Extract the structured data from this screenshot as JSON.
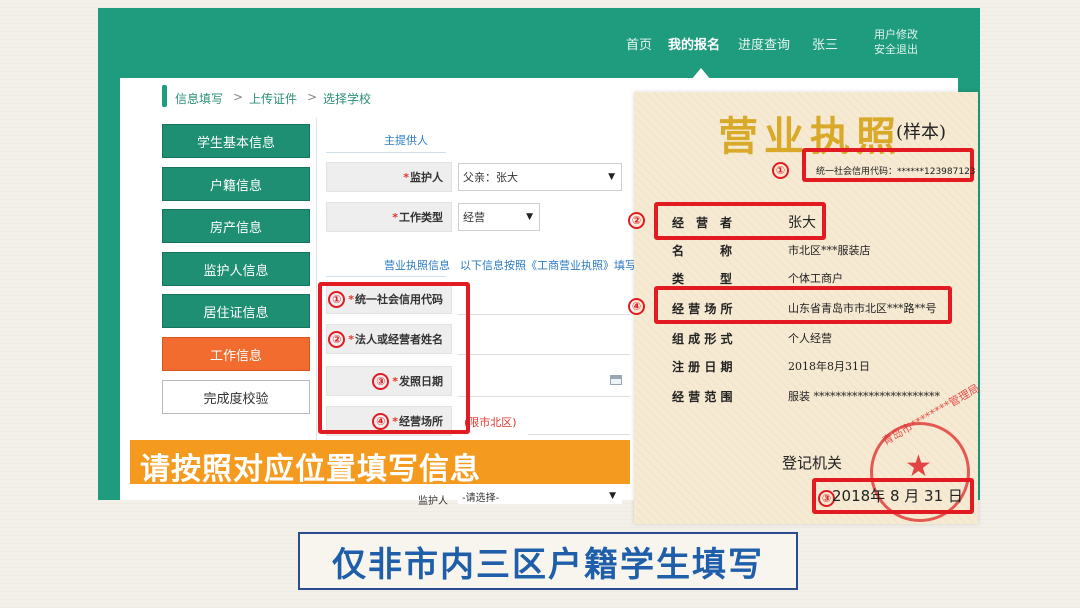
{
  "navbar": {
    "items": [
      "首页",
      "我的报名",
      "进度查询",
      "张三"
    ],
    "active_index": 1,
    "user_edit": "用户修改",
    "logout": "安全退出"
  },
  "breadcrumb": {
    "step1": "信息填写",
    "sep1": ">",
    "step2": "上传证件",
    "sep2": ">",
    "step3": "选择学校"
  },
  "sidebar": {
    "items": [
      "学生基本信息",
      "户籍信息",
      "房产信息",
      "监护人信息",
      "居住证信息",
      "工作信息",
      "完成度校验"
    ],
    "active_index": 5
  },
  "form": {
    "main_provider": "主提供人",
    "guardian_label": "监护人",
    "guardian_value": "父亲：张大",
    "work_type_label": "工作类型",
    "work_type_value": "经营",
    "license_info": "营业执照信息",
    "license_hint": "以下信息按照《工商营业执照》填写",
    "field1_label": "统一社会信用代码",
    "field2_label": "法人或经营者姓名",
    "field3_label": "发照日期",
    "field4_label": "经营场所",
    "field4_hint": "(限市北区)",
    "partial_label": "监护人",
    "partial_select": "-请选择-",
    "required_mark": "*"
  },
  "annotations": {
    "n1": "①",
    "n2": "②",
    "n3": "③",
    "n4": "④",
    "banner": "请按照对应位置填写信息",
    "bottom_caption": "仅非市内三区户籍学生填写"
  },
  "license": {
    "title": "营业执照",
    "sample": "(样本)",
    "credit_code": "统一社会信用代码：******123987123",
    "rows": [
      {
        "label": "经　营　者",
        "value": "张大"
      },
      {
        "label": "名　　　称",
        "value": "市北区***服装店"
      },
      {
        "label": "类　　　型",
        "value": "个体工商户"
      },
      {
        "label": "经 营 场 所",
        "value": "山东省青岛市市北区***路**号"
      },
      {
        "label": "组 成 形 式",
        "value": "个人经营"
      },
      {
        "label": "注 册 日 期",
        "value": "2018年8月31日"
      },
      {
        "label": "经 营 范 围",
        "value": "服装 ***********************"
      }
    ],
    "authority": "登记机关",
    "issue_date": "2018年 8 月 31 日",
    "seal_text": "青岛市********管理局"
  },
  "colors": {
    "brand_green": "#1f9b7e",
    "active_orange": "#f26b2f",
    "annotation_red": "#e21b23",
    "banner_orange": "#f39a1f",
    "caption_blue": "#1f5ea8"
  }
}
